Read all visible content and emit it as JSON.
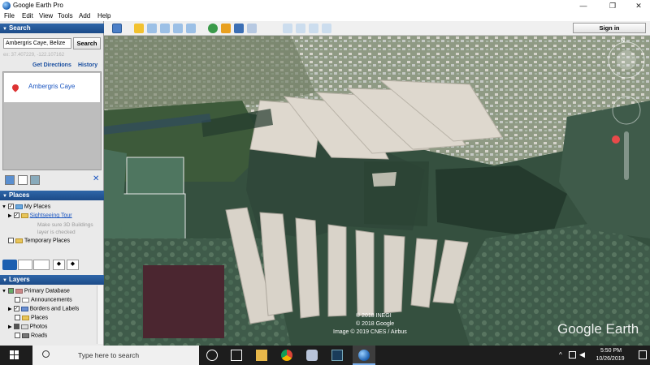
{
  "app": {
    "title": "Google Earth Pro"
  },
  "menu": [
    "File",
    "Edit",
    "View",
    "Tools",
    "Add",
    "Help"
  ],
  "search": {
    "header": "Search",
    "query": "Ambergris Caye, Belize",
    "button": "Search",
    "hint": "ex: 37.407229, -122.107162",
    "get_directions": "Get Directions",
    "history": "History",
    "result": "Ambergris Caye"
  },
  "places": {
    "header": "Places",
    "my_places": "My Places",
    "sightseeing": "Sightseeing Tour",
    "note": "Make sure 3D Buildings layer is checked",
    "temporary": "Temporary Places"
  },
  "layers": {
    "header": "Layers",
    "items": [
      "Primary Database",
      "Announcements",
      "Borders and Labels",
      "Places",
      "Photos",
      "Roads"
    ]
  },
  "toolbar": {
    "sign_in": "Sign in"
  },
  "map": {
    "attribution_1": "© 2018 INEGI",
    "attribution_2": "© 2018 Google",
    "attribution_3": "Image © 2019 CNES / Airbus",
    "watermark": "Google Earth",
    "compass_label": "N"
  },
  "taskbar": {
    "search_placeholder": "Type here to search",
    "time": "5:50 PM",
    "date": "10/26/2019"
  }
}
